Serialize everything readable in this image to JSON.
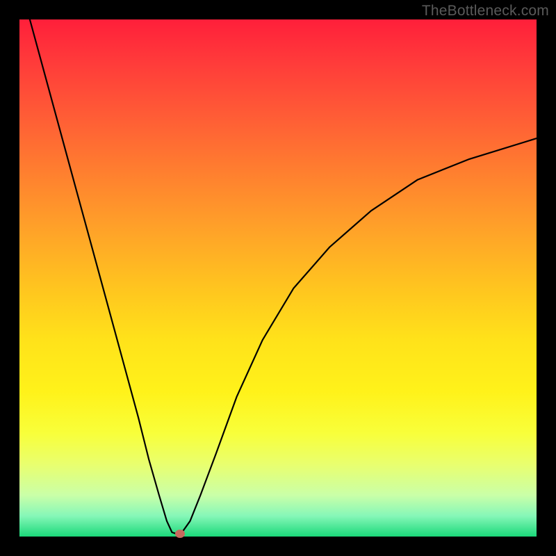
{
  "watermark": "TheBottleneck.com",
  "colors": {
    "frame_bg": "#000000",
    "curve_stroke": "#000000",
    "marker_fill": "#c76a5e",
    "gradient_top": "#ff1f3a",
    "gradient_bottom": "#1bd97a"
  },
  "chart_data": {
    "type": "line",
    "title": "",
    "xlabel": "",
    "ylabel": "",
    "xlim": [
      0,
      100
    ],
    "ylim": [
      0,
      100
    ],
    "grid": false,
    "legend": false,
    "series": [
      {
        "name": "bottleneck-curve",
        "x": [
          2,
          5,
          8,
          11,
          14,
          17,
          20,
          23,
          25,
          27,
          28.5,
          29.5,
          30.5,
          31.5,
          33,
          35,
          38,
          42,
          47,
          53,
          60,
          68,
          77,
          87,
          100
        ],
        "y": [
          100,
          89,
          78,
          67,
          56,
          45,
          34,
          23,
          15,
          8,
          3,
          0.8,
          0.5,
          0.9,
          3,
          8,
          16,
          27,
          38,
          48,
          56,
          63,
          69,
          73,
          77
        ]
      }
    ],
    "marker": {
      "x": 31,
      "y": 0.5
    },
    "notes": "y is percentage height from bottom; curve forms a V with minimum near x≈30."
  }
}
